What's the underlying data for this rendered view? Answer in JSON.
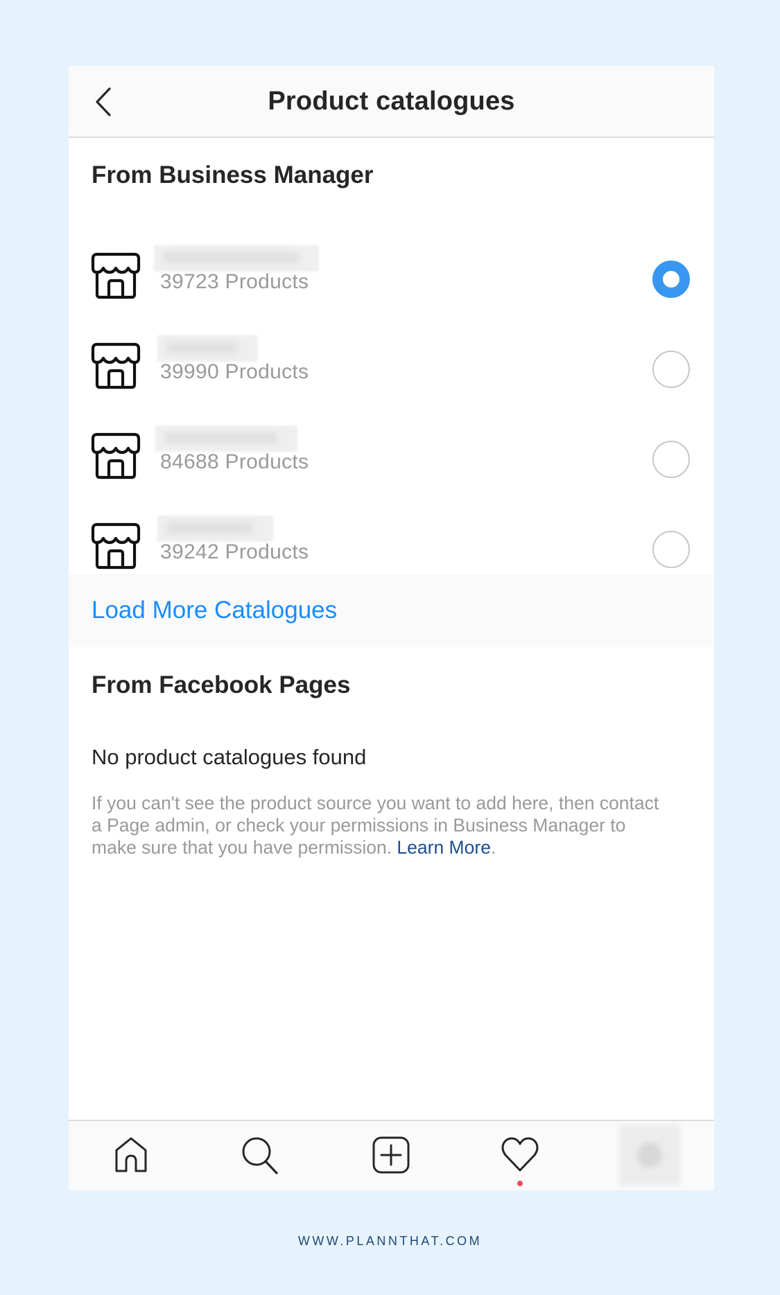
{
  "header": {
    "title": "Product catalogues",
    "back_icon": "chevron-left-icon"
  },
  "business_manager": {
    "heading": "From Business Manager",
    "catalogues": [
      {
        "name": "[blurred]",
        "count_label": "39723 Products",
        "selected": true
      },
      {
        "name": "[blurred]",
        "count_label": "39990 Products",
        "selected": false
      },
      {
        "name": "[blurred]",
        "count_label": "84688 Products",
        "selected": false
      },
      {
        "name": "[blurred]",
        "count_label": "39242 Products",
        "selected": false
      }
    ],
    "load_more_label": "Load More Catalogues"
  },
  "facebook_pages": {
    "heading": "From Facebook Pages",
    "empty_title": "No product catalogues found",
    "help_text": "If you can't see the product source you want to add here, then contact a Page admin, or check your permissions in Business Manager to make sure that you have permission.",
    "learn_more_label": "Learn More",
    "help_suffix": "."
  },
  "tabbar": {
    "items": [
      {
        "icon": "home-icon"
      },
      {
        "icon": "search-icon"
      },
      {
        "icon": "add-post-icon"
      },
      {
        "icon": "heart-icon",
        "has_notification": true
      },
      {
        "icon": "profile-avatar"
      }
    ]
  },
  "colors": {
    "accent": "#3897f0",
    "link": "#1a8cff",
    "learn_more": "#1d4f91",
    "notification": "#ed4956",
    "background": "#e6f2fe"
  },
  "footer": {
    "text": "WWW.PLANNTHAT.COM"
  }
}
